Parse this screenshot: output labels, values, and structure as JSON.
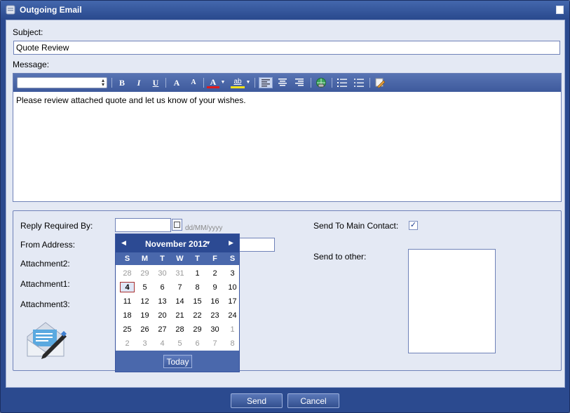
{
  "window": {
    "title": "Outgoing Email"
  },
  "subject": {
    "label": "Subject:",
    "value": "Quote Review"
  },
  "message": {
    "label": "Message:",
    "body": "Please review attached quote and let us know of your wishes."
  },
  "toolbar": {
    "bold": "B",
    "italic": "I",
    "underline": "U",
    "grow_font": "A",
    "shrink_font": "A",
    "font_color": "A",
    "highlight": "ab"
  },
  "form": {
    "reply_required_label": "Reply Required By:",
    "date_placeholder": "dd/MM/yyyy",
    "from_address_label": "From Address:",
    "attachment2_label": "Attachment2:",
    "attachment1_label": "Attachment1:",
    "attachment3_label": "Attachment3:",
    "send_main_contact_label": "Send To Main Contact:",
    "send_main_contact_checked": true,
    "send_other_label": "Send to other:"
  },
  "calendar": {
    "month_label": "November 2012",
    "weekdays": [
      "S",
      "M",
      "T",
      "W",
      "T",
      "F",
      "S"
    ],
    "weeks": [
      [
        "28",
        "29",
        "30",
        "31",
        "1",
        "2",
        "3"
      ],
      [
        "4",
        "5",
        "6",
        "7",
        "8",
        "9",
        "10"
      ],
      [
        "11",
        "12",
        "13",
        "14",
        "15",
        "16",
        "17"
      ],
      [
        "18",
        "19",
        "20",
        "21",
        "22",
        "23",
        "24"
      ],
      [
        "25",
        "26",
        "27",
        "28",
        "29",
        "30",
        "1"
      ],
      [
        "2",
        "3",
        "4",
        "5",
        "6",
        "7",
        "8"
      ]
    ],
    "selected_day": "4",
    "today_label": "Today"
  },
  "buttons": {
    "send": "Send",
    "cancel": "Cancel"
  },
  "colors": {
    "titlebar": "#2b4a8f",
    "panel": "#e4e9f4",
    "accent": "#3a55a0"
  }
}
